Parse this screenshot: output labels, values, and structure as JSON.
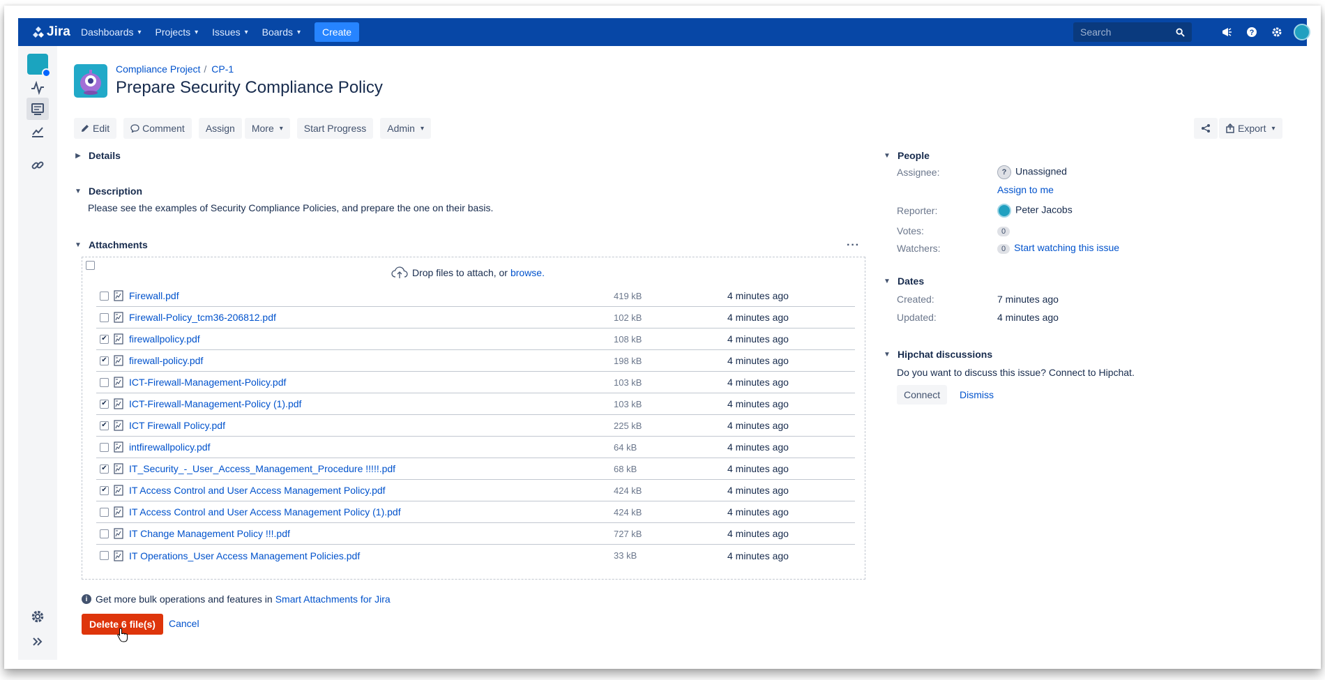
{
  "topnav": {
    "logo_text": "Jira",
    "menu": [
      {
        "label": "Dashboards"
      },
      {
        "label": "Projects"
      },
      {
        "label": "Issues"
      },
      {
        "label": "Boards"
      }
    ],
    "create_label": "Create",
    "search_placeholder": "Search",
    "brand_color": "#0747a6"
  },
  "breadcrumb": {
    "project": "Compliance Project",
    "issue_key": "CP-1"
  },
  "issue": {
    "title": "Prepare Security Compliance Policy",
    "toolbar": {
      "edit": "Edit",
      "comment": "Comment",
      "assign": "Assign",
      "more": "More",
      "start_progress": "Start Progress",
      "admin": "Admin",
      "export": "Export"
    }
  },
  "details": {
    "heading": "Details"
  },
  "description": {
    "heading": "Description",
    "text": "Please see the examples of Security Compliance Policies, and prepare the one on their basis."
  },
  "attachments": {
    "heading": "Attachments",
    "drop_text": "Drop files to attach, or",
    "browse": "browse.",
    "files": [
      {
        "name": "Firewall.pdf",
        "size": "419 kB",
        "time": "4 minutes ago",
        "checked": false
      },
      {
        "name": "Firewall-Policy_tcm36-206812.pdf",
        "size": "102 kB",
        "time": "4 minutes ago",
        "checked": false
      },
      {
        "name": "firewallpolicy.pdf",
        "size": "108 kB",
        "time": "4 minutes ago",
        "checked": true
      },
      {
        "name": "firewall-policy.pdf",
        "size": "198 kB",
        "time": "4 minutes ago",
        "checked": true
      },
      {
        "name": "ICT-Firewall-Management-Policy.pdf",
        "size": "103 kB",
        "time": "4 minutes ago",
        "checked": false
      },
      {
        "name": "ICT-Firewall-Management-Policy (1).pdf",
        "size": "103 kB",
        "time": "4 minutes ago",
        "checked": true
      },
      {
        "name": "ICT Firewall Policy.pdf",
        "size": "225 kB",
        "time": "4 minutes ago",
        "checked": true
      },
      {
        "name": "intfirewallpolicy.pdf",
        "size": "64 kB",
        "time": "4 minutes ago",
        "checked": false
      },
      {
        "name": "IT_Security_-_User_Access_Management_Procedure !!!!!.pdf",
        "size": "68 kB",
        "time": "4 minutes ago",
        "checked": true
      },
      {
        "name": "IT Access Control and User Access Management Policy.pdf",
        "size": "424 kB",
        "time": "4 minutes ago",
        "checked": true
      },
      {
        "name": "IT Access Control and User Access Management Policy (1).pdf",
        "size": "424 kB",
        "time": "4 minutes ago",
        "checked": false
      },
      {
        "name": "IT Change Management Policy !!!.pdf",
        "size": "727 kB",
        "time": "4 minutes ago",
        "checked": false
      },
      {
        "name": "IT Operations_User Access Management Policies.pdf",
        "size": "33 kB",
        "time": "4 minutes ago",
        "checked": false
      }
    ],
    "bulk_note": "Get more bulk operations and features in",
    "bulk_link": "Smart Attachments for Jira",
    "delete_label": "Delete 6 file(s)",
    "cancel_label": "Cancel",
    "delete_color": "#de350b"
  },
  "people": {
    "heading": "People",
    "assignee_label": "Assignee:",
    "assignee_value": "Unassigned",
    "assign_to_me": "Assign to me",
    "reporter_label": "Reporter:",
    "reporter_value": "Peter Jacobs",
    "votes_label": "Votes:",
    "votes_value": "0",
    "watchers_label": "Watchers:",
    "watchers_value": "0",
    "watch_link": "Start watching this issue"
  },
  "dates": {
    "heading": "Dates",
    "created_label": "Created:",
    "created_value": "7 minutes ago",
    "updated_label": "Updated:",
    "updated_value": "4 minutes ago"
  },
  "hipchat": {
    "heading": "Hipchat discussions",
    "text": "Do you want to discuss this issue? Connect to Hipchat.",
    "connect": "Connect",
    "dismiss": "Dismiss"
  }
}
